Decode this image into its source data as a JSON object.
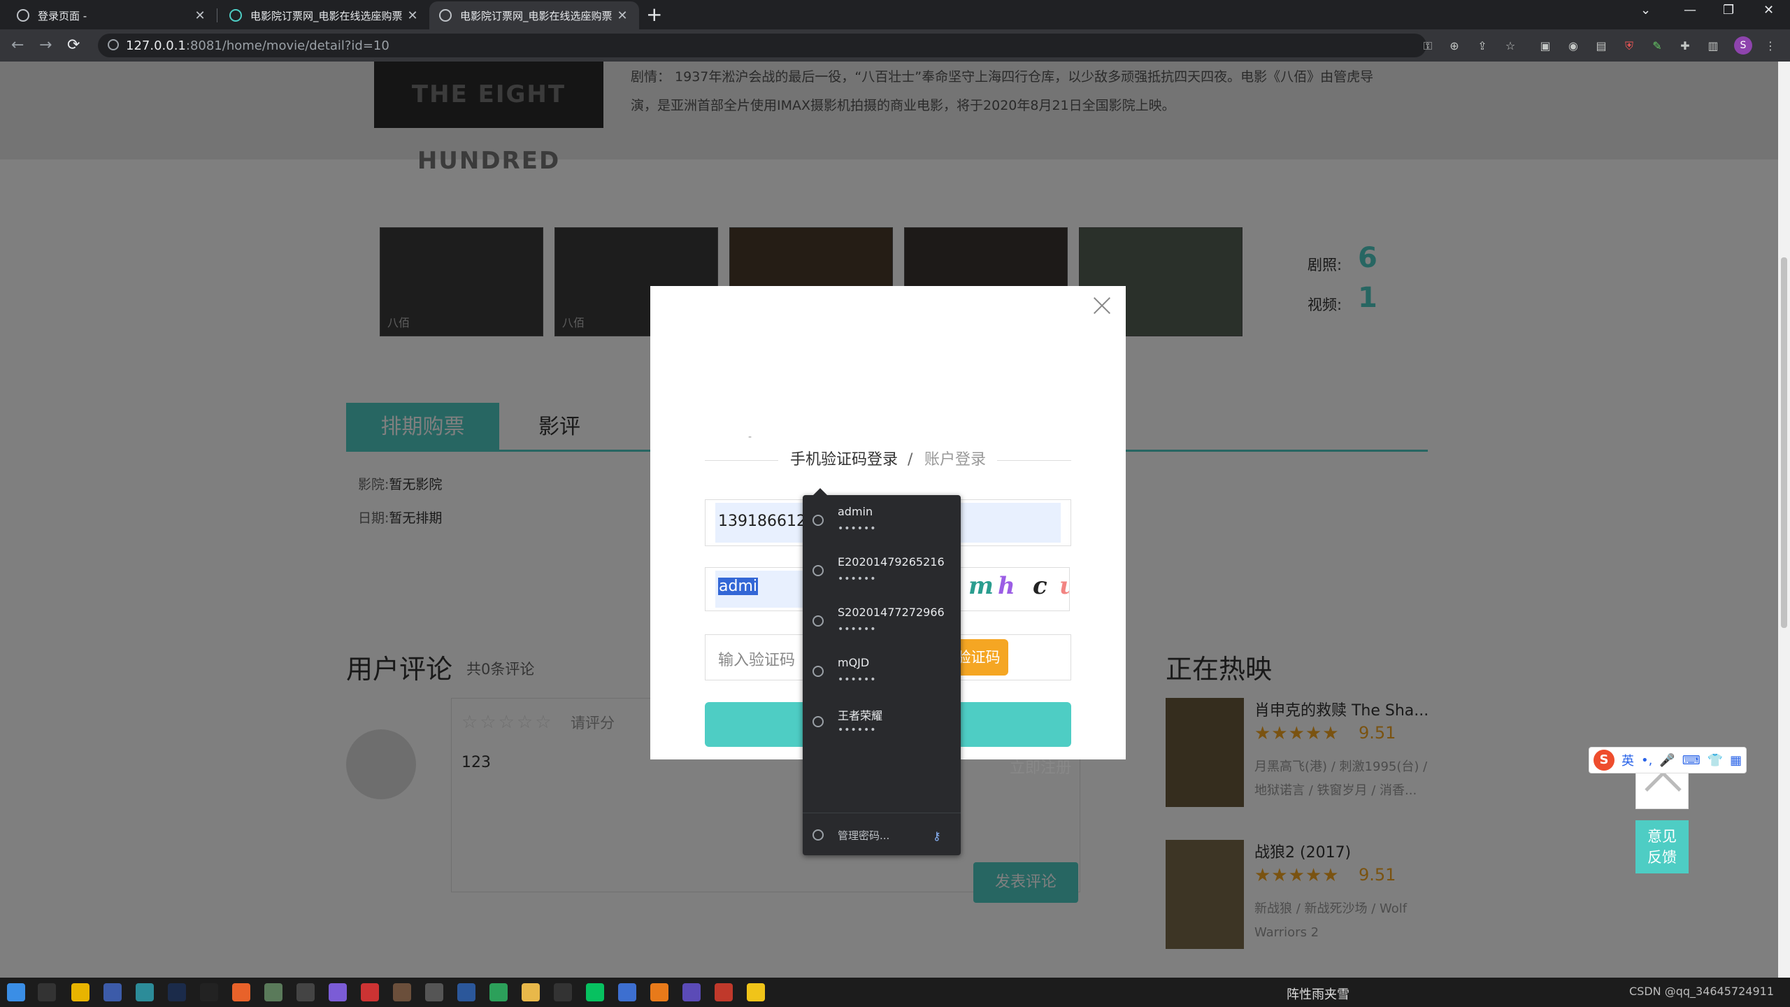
{
  "browser": {
    "tabs": [
      {
        "title": "登录页面 -",
        "active": false
      },
      {
        "title": "电影院订票网_电影在线选座购票",
        "active": false
      },
      {
        "title": "电影院订票网_电影在线选座购票",
        "active": true
      }
    ],
    "new_tab": "+",
    "url_host": "127.0.0.1",
    "url_path": ":8081/home/movie/detail?id=10",
    "profile_initial": "S"
  },
  "page": {
    "poster_top_text": "THE EIGHT HUNDRED",
    "synopsis": "剧情：  1937年淞沪会战的最后一役，“八百壮士”奉命坚守上海四行仓库，以少敌多顽强抵抗四天四夜。电影《八佰》由管虎导演，是亚洲首部全片使用IMAX摄影机拍摄的商业电影，将于2020年8月21日全国影院上映。",
    "stills_caption": "八佰",
    "stats": {
      "stills_label": "剧照:",
      "stills_count": "6",
      "video_label": "视频:",
      "video_count": "1"
    },
    "tabs": {
      "schedule": "排期购票",
      "reviews": "影评"
    },
    "cinema_label": "影院:",
    "cinema_value": "暂无影院",
    "date_label": "日期:",
    "date_value": "暂无排期",
    "comments": {
      "title": "用户评论",
      "count": "共0条评论",
      "rate_stars": "☆☆☆☆☆",
      "rate_hint": "请评分",
      "text": "123",
      "publish": "发表评论"
    },
    "hot": {
      "title": "正在热映",
      "movies": [
        {
          "title": "肖申克的救赎 The Sha...",
          "stars": "★★★★★",
          "score": "9.51",
          "desc": "月黑高飞(港) / 刺激1995(台) / 地狱诺言 / 铁窗岁月 / 消香..."
        },
        {
          "title": "战狼2 (2017)",
          "stars": "★★★★★",
          "score": "9.51",
          "desc": "新战狼 / 新战死沙场 / Wolf Warriors 2"
        }
      ]
    },
    "feedback": "意见\n反馈"
  },
  "modal": {
    "dash": "-",
    "tab_phone": "手机验证码登录",
    "tab_sep": "/",
    "tab_account": "账户登录",
    "phone_value": "13918661215",
    "captcha_input_value": "admi",
    "captcha_chars": [
      "m",
      "h",
      "c",
      "u"
    ],
    "sms_placeholder": "输入验证码",
    "get_code": "获取验证码",
    "register": "立即注册"
  },
  "autofill": {
    "items": [
      {
        "user": "admin",
        "pass": "••••••"
      },
      {
        "user": "E20201479265216",
        "pass": "••••••"
      },
      {
        "user": "S20201477272966",
        "pass": "••••••"
      },
      {
        "user": "mQJD",
        "pass": "••••••"
      },
      {
        "user": "王者荣耀",
        "pass": "••••••"
      }
    ],
    "manage": "管理密码..."
  },
  "ime": {
    "lang": "英"
  },
  "taskbar": {
    "weather": "阵性雨夹雪",
    "tray_text": "CSDN @qq_34645724911"
  }
}
